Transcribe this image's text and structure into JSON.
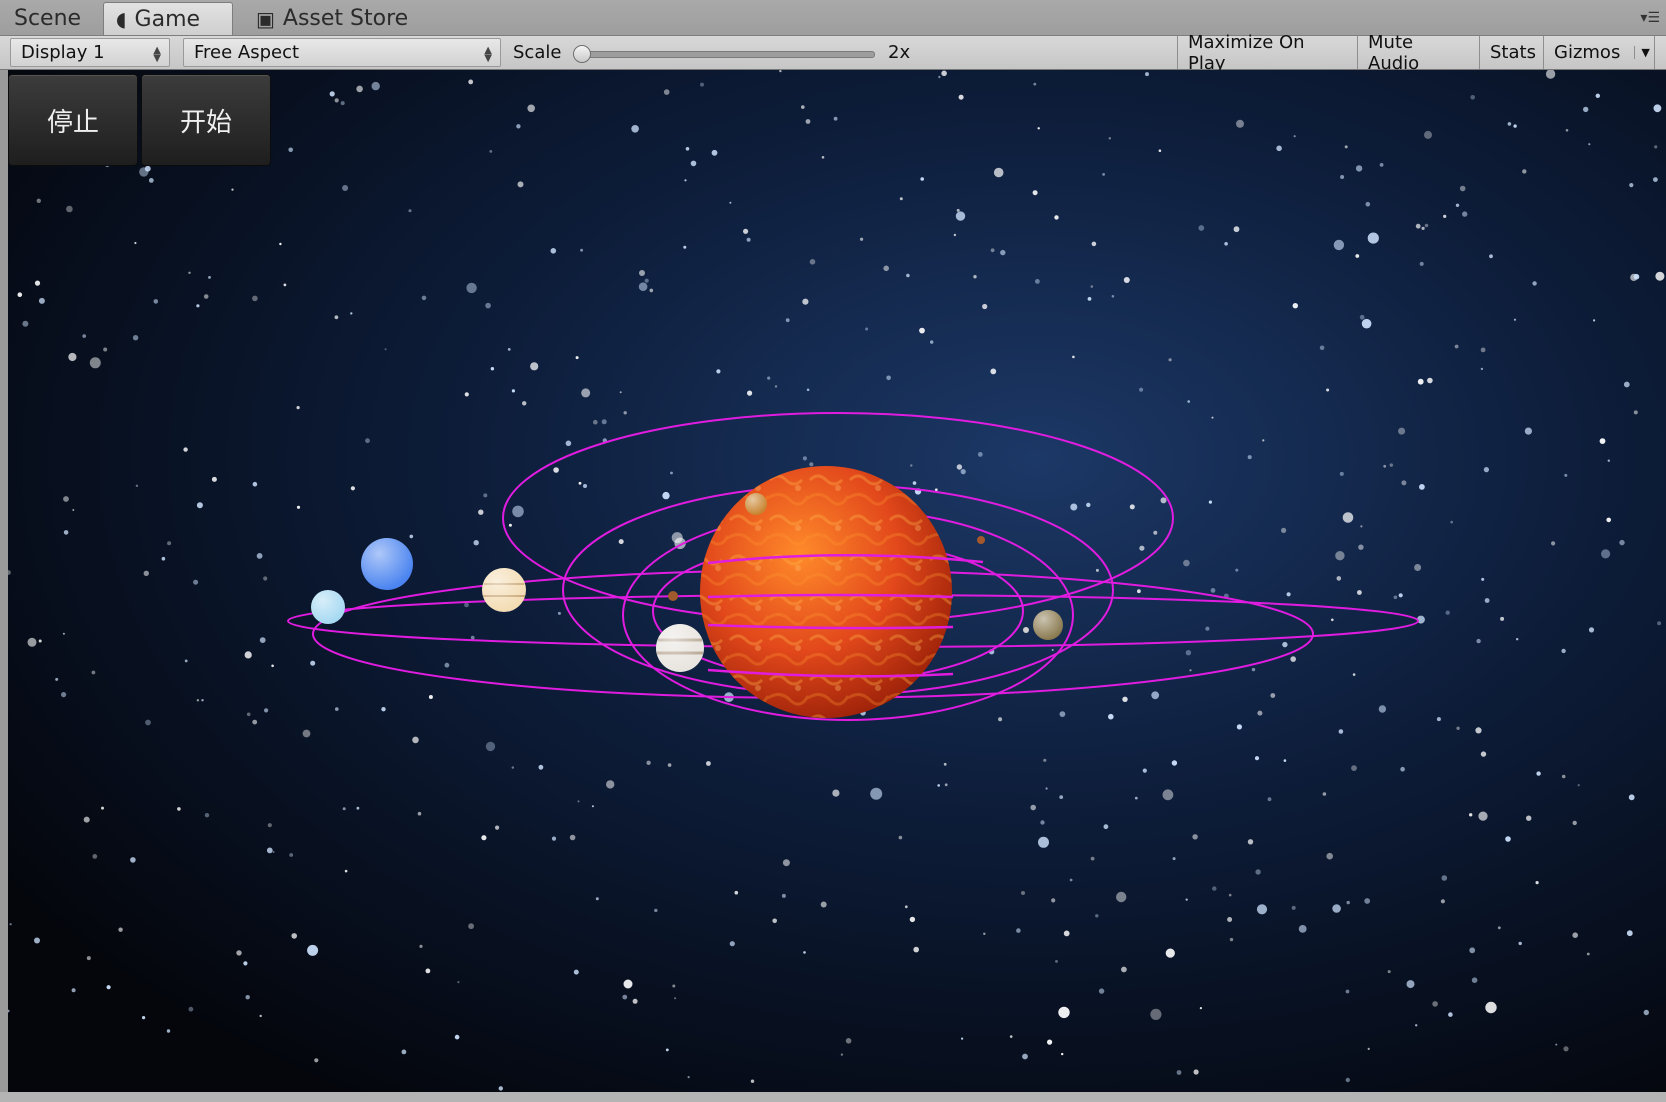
{
  "tabs": [
    {
      "label": "Scene",
      "icon": "",
      "active": false
    },
    {
      "label": "Game",
      "icon": "pacman-icon",
      "active": true
    },
    {
      "label": "Asset Store",
      "icon": "shopping-bag-icon",
      "active": false
    }
  ],
  "toolbar": {
    "display": "Display 1",
    "aspect": "Free Aspect",
    "scale_label": "Scale",
    "scale_value": "2x",
    "scale_level": 0.0,
    "maximize": "Maximize On Play",
    "mute": "Mute Audio",
    "stats": "Stats",
    "gizmos": "Gizmos"
  },
  "game": {
    "buttons": {
      "stop": "停止",
      "start": "开始"
    },
    "colors": {
      "space": "#05080f",
      "orbit": "#e01ce0",
      "sun": "#e8521a"
    },
    "bodies": [
      {
        "name": "sun",
        "color": "#e2481b"
      },
      {
        "name": "mercury",
        "color": "#a05a2c"
      },
      {
        "name": "venus",
        "color": "#c8842f"
      },
      {
        "name": "earth",
        "color": "#8a7a50"
      },
      {
        "name": "mars",
        "color": "#a3592d"
      },
      {
        "name": "jupiter",
        "color": "#e8e4df"
      },
      {
        "name": "saturn",
        "color": "#f3dcb3"
      },
      {
        "name": "uranus",
        "color": "#a6d9f2"
      },
      {
        "name": "neptune",
        "color": "#4b84f0"
      }
    ]
  }
}
